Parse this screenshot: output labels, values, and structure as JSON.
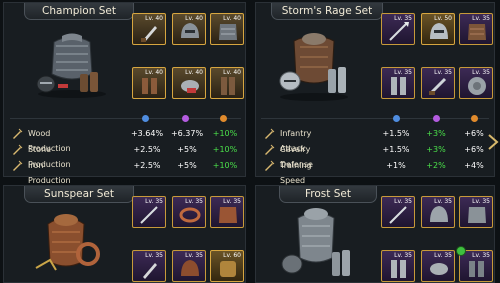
{
  "sets": {
    "champion": {
      "title": "Champion Set",
      "slot_levels": [
        "Lv. 40",
        "Lv. 40",
        "Lv. 40",
        "Lv. 40",
        "Lv. 40",
        "Lv. 40"
      ],
      "stats": [
        {
          "name": "Wood Production",
          "v1": "+3.64%",
          "v2": "+6.37%",
          "v3": "+10%"
        },
        {
          "name": "Stone Production",
          "v1": "+2.5%",
          "v2": "+5%",
          "v3": "+10%"
        },
        {
          "name": "Iron Production",
          "v1": "+2.5%",
          "v2": "+5%",
          "v3": "+10%"
        }
      ]
    },
    "storm": {
      "title": "Storm's Rage Set",
      "slot_levels": [
        "Lv. 35",
        "Lv. 50",
        "Lv. 35",
        "Lv. 35",
        "Lv. 35",
        "Lv. 35"
      ],
      "stats": [
        {
          "name": "Infantry Attack",
          "v1": "+1.5%",
          "v2": "+3%",
          "v3": "+6%"
        },
        {
          "name": "Cavalry Defense",
          "v1": "+1.5%",
          "v2": "+3%",
          "v3": "+6%"
        },
        {
          "name": "Training Speed",
          "v1": "+1%",
          "v2": "+2%",
          "v3": "+4%"
        }
      ]
    },
    "sunspear": {
      "title": "Sunspear Set",
      "slot_levels": [
        "Lv. 35",
        "Lv. 35",
        "Lv. 35",
        "Lv. 35",
        "Lv. 35",
        "Lv. 60"
      ]
    },
    "frost": {
      "title": "Frost Set",
      "slot_levels": [
        "Lv. 35",
        "Lv. 35",
        "Lv. 35",
        "Lv. 35",
        "Lv. 35",
        "Lv. 35"
      ]
    }
  },
  "tier_dot_colors": [
    "#4f8de0",
    "#b45ce0",
    "#e08a2c"
  ],
  "colors": {
    "panel_bg": "#181d21",
    "slot_border": "#d7a640",
    "bonus_green": "#4ae04a",
    "text_light": "#e9e2cd"
  },
  "icons": {
    "stat_icon": "sword-icon",
    "next_icon": "chevron-right-icon"
  }
}
